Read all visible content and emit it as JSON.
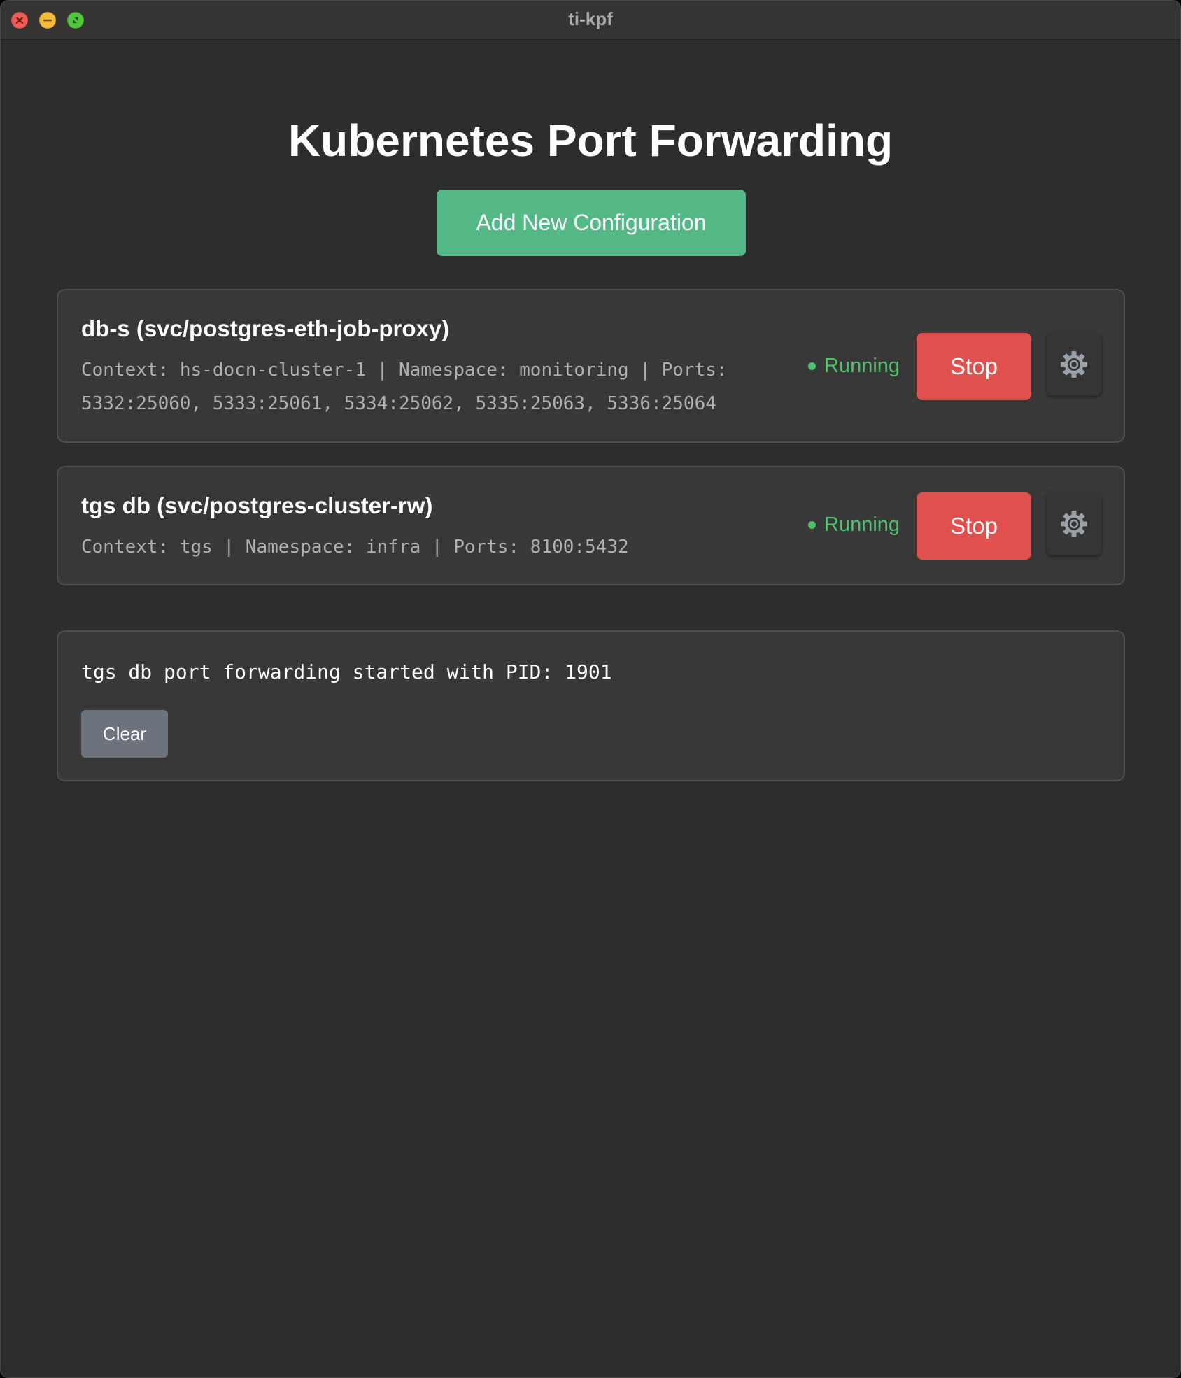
{
  "window": {
    "title": "ti-kpf",
    "controls": [
      "close-icon",
      "minimize-icon",
      "zoom-icon"
    ]
  },
  "header": {
    "title": "Kubernetes Port Forwarding",
    "add_button_label": "Add New Configuration"
  },
  "configs": [
    {
      "title": "db-s (svc/postgres-eth-job-proxy)",
      "details": "Context: hs-docn-cluster-1 | Namespace: monitoring | Ports: 5332:25060, 5333:25061, 5334:25062, 5335:25063, 5336:25064",
      "status": "Running",
      "stop_label": "Stop",
      "settings_icon": "gear-icon"
    },
    {
      "title": "tgs db (svc/postgres-cluster-rw)",
      "details": "Context: tgs | Namespace: infra | Ports: 8100:5432",
      "status": "Running",
      "stop_label": "Stop",
      "settings_icon": "gear-icon"
    }
  ],
  "log": {
    "message": "tgs db port forwarding started with PID: 1901",
    "clear_label": "Clear"
  },
  "colors": {
    "background": "#2d2d2d",
    "card": "#383838",
    "accent_green": "#55b887",
    "status_green": "#4cc36a",
    "stop_red": "#e0504f",
    "clear_gray": "#6c737c"
  }
}
